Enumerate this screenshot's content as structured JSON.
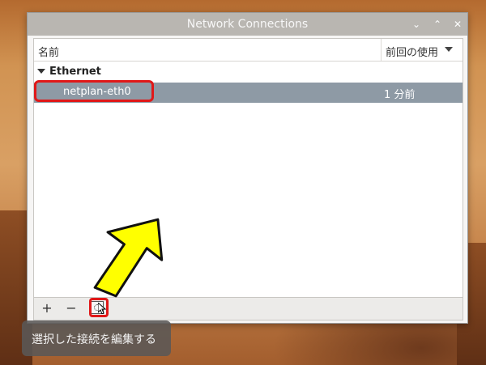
{
  "window": {
    "title": "Network Connections",
    "controls": {
      "minimize": "⌄",
      "maximize": "⌃",
      "close": "✕"
    }
  },
  "list": {
    "columns": {
      "name": "名前",
      "last_used": "前回の使用"
    },
    "groups": [
      {
        "label": "Ethernet",
        "connections": [
          {
            "name": "netplan-eth0",
            "last_used": "1 分前"
          }
        ]
      }
    ]
  },
  "toolbar": {
    "add_label": "+",
    "remove_label": "−"
  },
  "tooltip": {
    "text": "選択した接続を編集する"
  },
  "colors": {
    "selection": "#8e9aa5",
    "titlebar": "#b9b6b1",
    "annotation_red": "#e01818",
    "annotation_yellow": "#ffff00"
  }
}
